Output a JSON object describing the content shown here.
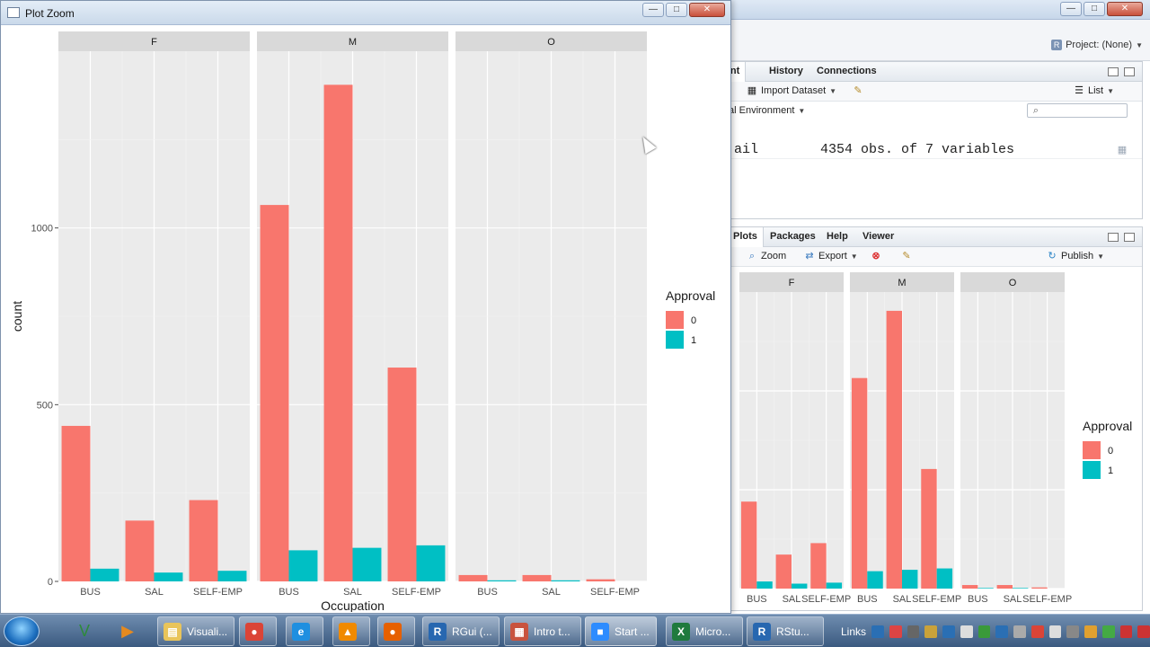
{
  "plot_window": {
    "title": "Plot Zoom",
    "controls": {
      "minimize": "—",
      "maximize": "□",
      "close": "✕"
    }
  },
  "rstudio": {
    "title_controls": {
      "minimize": "—",
      "maximize": "□",
      "close": "✕"
    },
    "project_label": "Project: (None)",
    "env_pane": {
      "tabs": [
        "ment",
        "History",
        "Connections"
      ],
      "toolbar": {
        "import_dataset": "Import Dataset",
        "view_mode": "List"
      },
      "environment_label": "al Environment",
      "search_placeholder": "",
      "rows": [
        {
          "name": "ail",
          "value": "4354 obs. of 7 variables"
        }
      ]
    },
    "plots_pane": {
      "tabs": [
        "Plots",
        "Packages",
        "Help",
        "Viewer"
      ],
      "toolbar": {
        "zoom": "Zoom",
        "export": "Export",
        "publish": "Publish"
      }
    }
  },
  "chart_data": [
    {
      "type": "bar",
      "facets": [
        "F",
        "M",
        "O"
      ],
      "categories": [
        "BUS",
        "SAL",
        "SELF-EMP"
      ],
      "xlabel": "Occupation",
      "ylabel": "count",
      "ylim": [
        0,
        1500
      ],
      "yticks": [
        0,
        500,
        1000
      ],
      "legend": {
        "title": "Approval",
        "position": "right"
      },
      "series": [
        {
          "name": "0",
          "color": "#F8766D",
          "values": {
            "F": [
              440,
              172,
              230
            ],
            "M": [
              1065,
              1405,
              605
            ],
            "O": [
              18,
              18,
              6
            ]
          }
        },
        {
          "name": "1",
          "color": "#00BFC4",
          "values": {
            "F": [
              36,
              25,
              30
            ],
            "M": [
              88,
              95,
              102
            ],
            "O": [
              3,
              3,
              0
            ]
          }
        }
      ],
      "grid": true,
      "theme": "ggplot2 gray"
    },
    {
      "type": "bar",
      "facets": [
        "F",
        "M",
        "O"
      ],
      "categories": [
        "BUS",
        "SAL",
        "SELF-EMP"
      ],
      "xlabel": "",
      "ylabel": "",
      "ylim": [
        0,
        1500
      ],
      "legend": {
        "title": "Approval",
        "position": "right"
      },
      "series": [
        {
          "name": "0",
          "color": "#F8766D",
          "values": {
            "F": [
              440,
              172,
              230
            ],
            "M": [
              1065,
              1405,
              605
            ],
            "O": [
              18,
              18,
              6
            ]
          }
        },
        {
          "name": "1",
          "color": "#00BFC4",
          "values": {
            "F": [
              36,
              25,
              30
            ],
            "M": [
              88,
              95,
              102
            ],
            "O": [
              3,
              3,
              0
            ]
          }
        }
      ],
      "grid": true,
      "theme": "ggplot2 gray"
    }
  ],
  "taskbar": {
    "pinned": [
      {
        "icon": "vim-icon",
        "glyph": "V",
        "color": "#2e8b3a"
      },
      {
        "icon": "media-player-icon",
        "glyph": "▶",
        "color": "#e58a1f"
      }
    ],
    "tasks": [
      {
        "label": "Visuali...",
        "icon": "folder-icon",
        "color": "#e9c45a",
        "glyph": "▤"
      },
      {
        "label": "",
        "icon": "chrome-icon",
        "color": "#db4437",
        "glyph": "●"
      },
      {
        "label": "",
        "icon": "internet-explorer-icon",
        "color": "#1f8fe0",
        "glyph": "e"
      },
      {
        "label": "",
        "icon": "vlc-icon",
        "color": "#f08a00",
        "glyph": "▲"
      },
      {
        "label": "",
        "icon": "firefox-icon",
        "color": "#e66000",
        "glyph": "●"
      },
      {
        "label": "RGui (...",
        "icon": "r-icon",
        "color": "#2767b0",
        "glyph": "R"
      },
      {
        "label": "Intro t...",
        "icon": "document-icon",
        "color": "#c9533e",
        "glyph": "▦"
      },
      {
        "label": "Start ...",
        "icon": "zoom-icon",
        "color": "#2d8cff",
        "glyph": "■"
      },
      {
        "label": "Micro...",
        "icon": "excel-icon",
        "color": "#1f7a3d",
        "glyph": "X"
      },
      {
        "label": "RStu...",
        "icon": "rstudio-icon",
        "color": "#2767b0",
        "glyph": "R"
      }
    ],
    "links_label": "Links"
  }
}
